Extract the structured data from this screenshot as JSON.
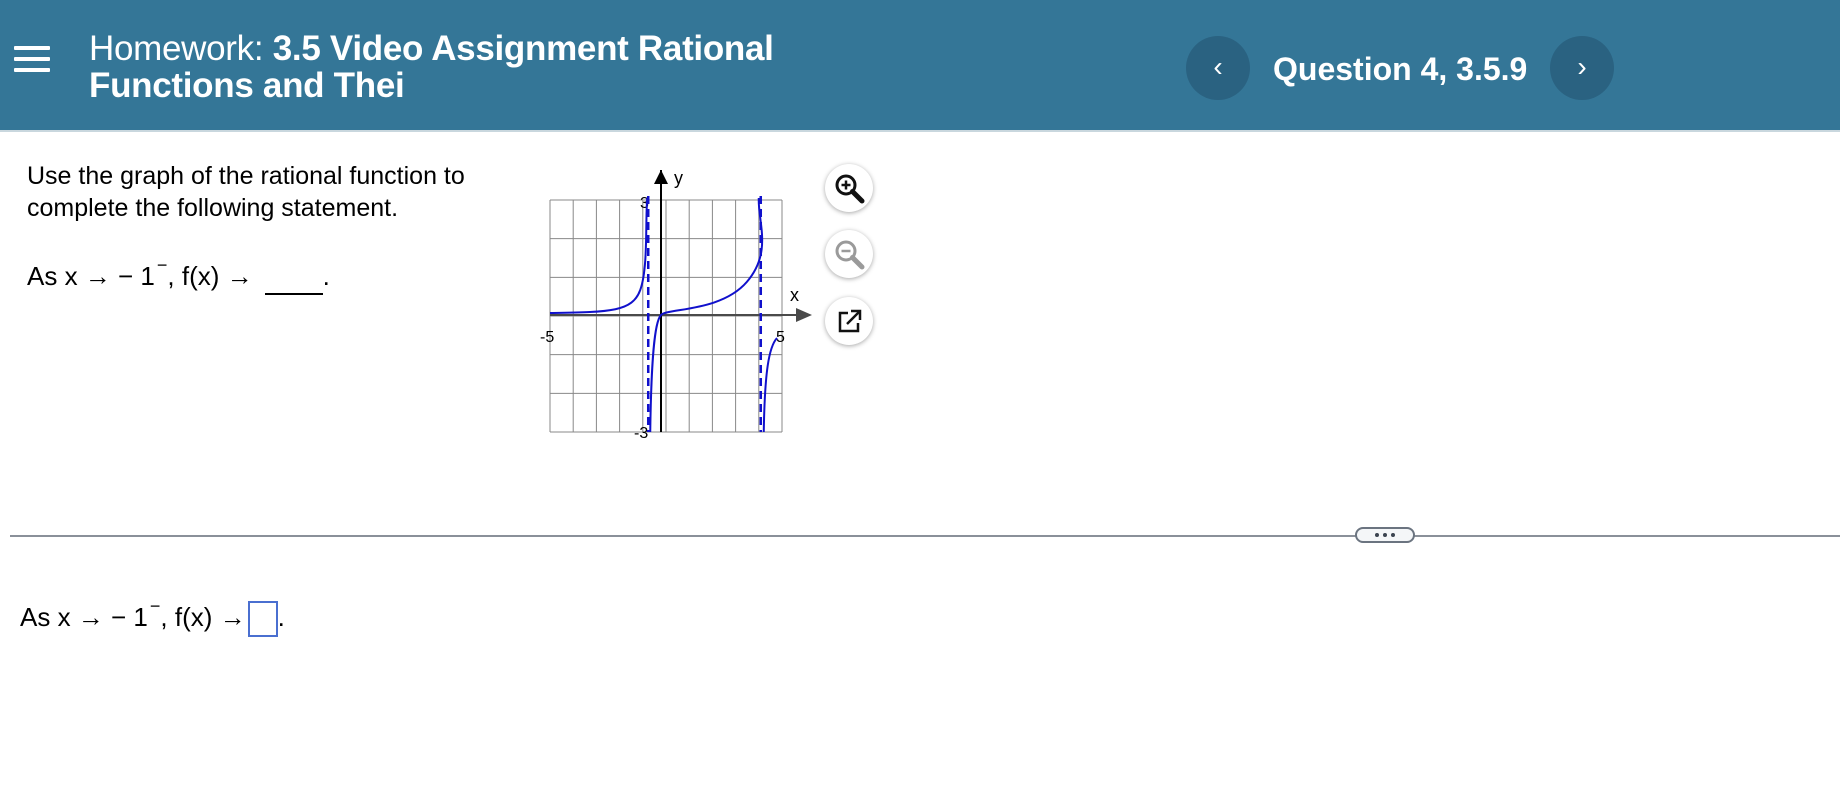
{
  "header": {
    "title_label": "Homework:",
    "title_name": "3.5 Video Assignment Rational Functions and Thei",
    "question": "Question 4, 3.5.9",
    "prev_glyph": "‹",
    "next_glyph": "›",
    "color": "#347697"
  },
  "problem": {
    "prompt": "Use the graph of the rational function to complete the following statement.",
    "statement_prefix": "As x → − 1",
    "superscript": "−",
    "statement_mid": ", f(x) →",
    "statement_end": "."
  },
  "answer": {
    "prefix": "As x → − 1",
    "superscript": "−",
    "mid": ", f(x) →",
    "end": ".",
    "value": ""
  },
  "graph": {
    "y_label": "y",
    "x_label": "x",
    "tick_top": "3",
    "tick_bottom": "-3",
    "tick_left": "-5",
    "tick_right": "5",
    "curve_color": "#1010cc"
  },
  "tools": {
    "zoom_in_icon": "zoom-in-icon",
    "zoom_out_icon": "zoom-out-icon",
    "popout_icon": "external-link-icon"
  }
}
